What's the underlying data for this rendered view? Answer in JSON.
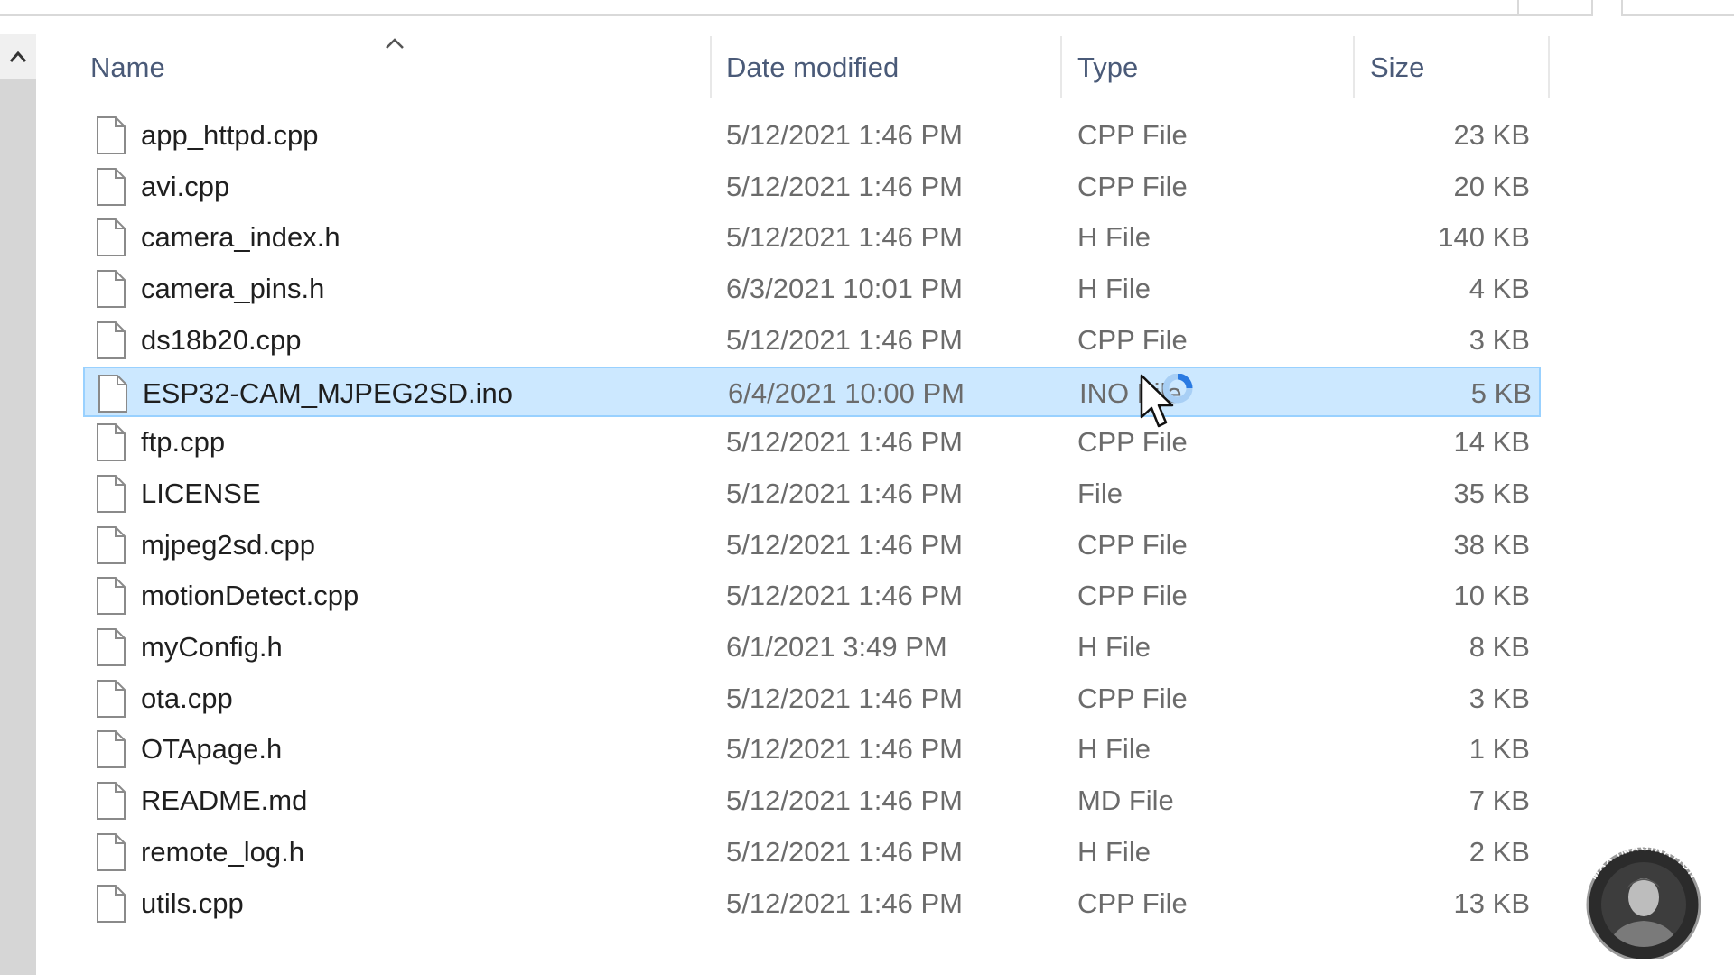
{
  "columns": {
    "name": "Name",
    "date": "Date modified",
    "type": "Type",
    "size": "Size"
  },
  "files": [
    {
      "name": "app_httpd.cpp",
      "date": "5/12/2021 1:46 PM",
      "type": "CPP File",
      "size": "23 KB"
    },
    {
      "name": "avi.cpp",
      "date": "5/12/2021 1:46 PM",
      "type": "CPP File",
      "size": "20 KB"
    },
    {
      "name": "camera_index.h",
      "date": "5/12/2021 1:46 PM",
      "type": "H File",
      "size": "140 KB"
    },
    {
      "name": "camera_pins.h",
      "date": "6/3/2021 10:01 PM",
      "type": "H File",
      "size": "4 KB"
    },
    {
      "name": "ds18b20.cpp",
      "date": "5/12/2021 1:46 PM",
      "type": "CPP File",
      "size": "3 KB"
    },
    {
      "name": "ESP32-CAM_MJPEG2SD.ino",
      "date": "6/4/2021 10:00 PM",
      "type": "INO File",
      "size": "5 KB",
      "selected": true
    },
    {
      "name": "ftp.cpp",
      "date": "5/12/2021 1:46 PM",
      "type": "CPP File",
      "size": "14 KB"
    },
    {
      "name": "LICENSE",
      "date": "5/12/2021 1:46 PM",
      "type": "File",
      "size": "35 KB"
    },
    {
      "name": "mjpeg2sd.cpp",
      "date": "5/12/2021 1:46 PM",
      "type": "CPP File",
      "size": "38 KB"
    },
    {
      "name": "motionDetect.cpp",
      "date": "5/12/2021 1:46 PM",
      "type": "CPP File",
      "size": "10 KB"
    },
    {
      "name": "myConfig.h",
      "date": "6/1/2021 3:49 PM",
      "type": "H File",
      "size": "8 KB"
    },
    {
      "name": "ota.cpp",
      "date": "5/12/2021 1:46 PM",
      "type": "CPP File",
      "size": "3 KB"
    },
    {
      "name": "OTApage.h",
      "date": "5/12/2021 1:46 PM",
      "type": "H File",
      "size": "1 KB"
    },
    {
      "name": "README.md",
      "date": "5/12/2021 1:46 PM",
      "type": "MD File",
      "size": "7 KB"
    },
    {
      "name": "remote_log.h",
      "date": "5/12/2021 1:46 PM",
      "type": "H File",
      "size": "2 KB"
    },
    {
      "name": "utils.cpp",
      "date": "5/12/2021 1:46 PM",
      "type": "CPP File",
      "size": "13 KB"
    }
  ],
  "icons": {
    "file": "file-icon",
    "sort": "sort-up-icon",
    "scroll_up": "chevron-up-icon",
    "cursor": "busy-cursor-icon"
  },
  "watermark": {
    "label": "MAX IMAGINATION"
  },
  "colors": {
    "selection_fill": "#cce8ff",
    "selection_border": "#99d1ff",
    "header_text": "#4a5a78",
    "busy_ring": "#2a7ae2"
  }
}
